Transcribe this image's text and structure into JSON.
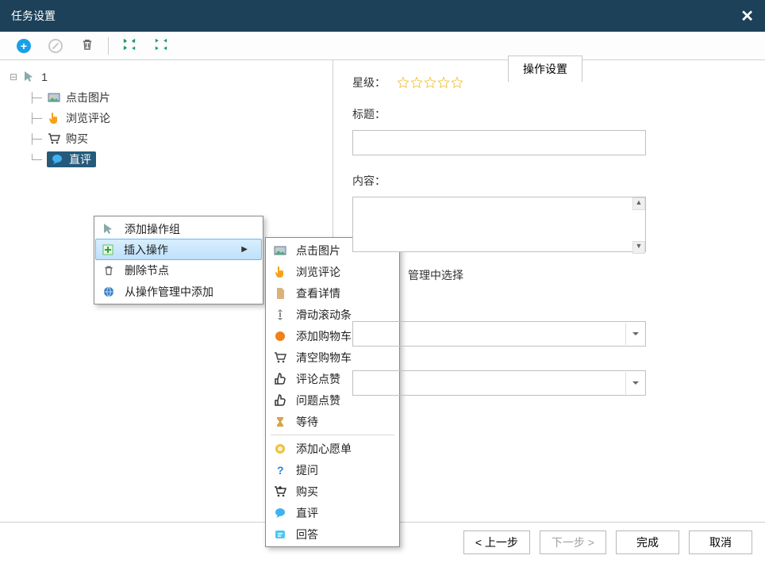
{
  "dialog": {
    "title": "任务设置",
    "close_glyph": "✕"
  },
  "tree": {
    "root": "1",
    "items": [
      {
        "label": "点击图片"
      },
      {
        "label": "浏览评论"
      },
      {
        "label": "购买"
      },
      {
        "label": "直评"
      }
    ]
  },
  "right": {
    "tab": "操作设置",
    "rating_label": "星级：",
    "title_label": "标题：",
    "title_value": "",
    "content_label": "内容：",
    "content_value": "",
    "hint_fragment": "管理中选择"
  },
  "context_menu": {
    "items": [
      {
        "label": "添加操作组"
      },
      {
        "label": "插入操作",
        "has_submenu": true
      },
      {
        "label": "删除节点"
      },
      {
        "label": "从操作管理中添加"
      }
    ]
  },
  "submenu": {
    "items": [
      {
        "label": "点击图片",
        "icon": "image"
      },
      {
        "label": "浏览评论",
        "icon": "pointer"
      },
      {
        "label": "查看详情",
        "icon": "doc"
      },
      {
        "label": "滑动滚动条",
        "icon": "scroll"
      },
      {
        "label": "添加购物车",
        "icon": "ball"
      },
      {
        "label": "清空购物车",
        "icon": "cart"
      },
      {
        "label": "评论点赞",
        "icon": "thumb"
      },
      {
        "label": "问题点赞",
        "icon": "thumb"
      },
      {
        "label": "等待",
        "icon": "hourglass"
      },
      {
        "sep": true
      },
      {
        "label": "添加心愿单",
        "icon": "globe"
      },
      {
        "label": "提问",
        "icon": "question"
      },
      {
        "label": "购买",
        "icon": "cartplus"
      },
      {
        "label": "直评",
        "icon": "bubble"
      },
      {
        "label": "回答",
        "icon": "answer"
      }
    ]
  },
  "footer": {
    "prev": "< 上一步",
    "next": "下一步 >",
    "finish": "完成",
    "cancel": "取消"
  }
}
